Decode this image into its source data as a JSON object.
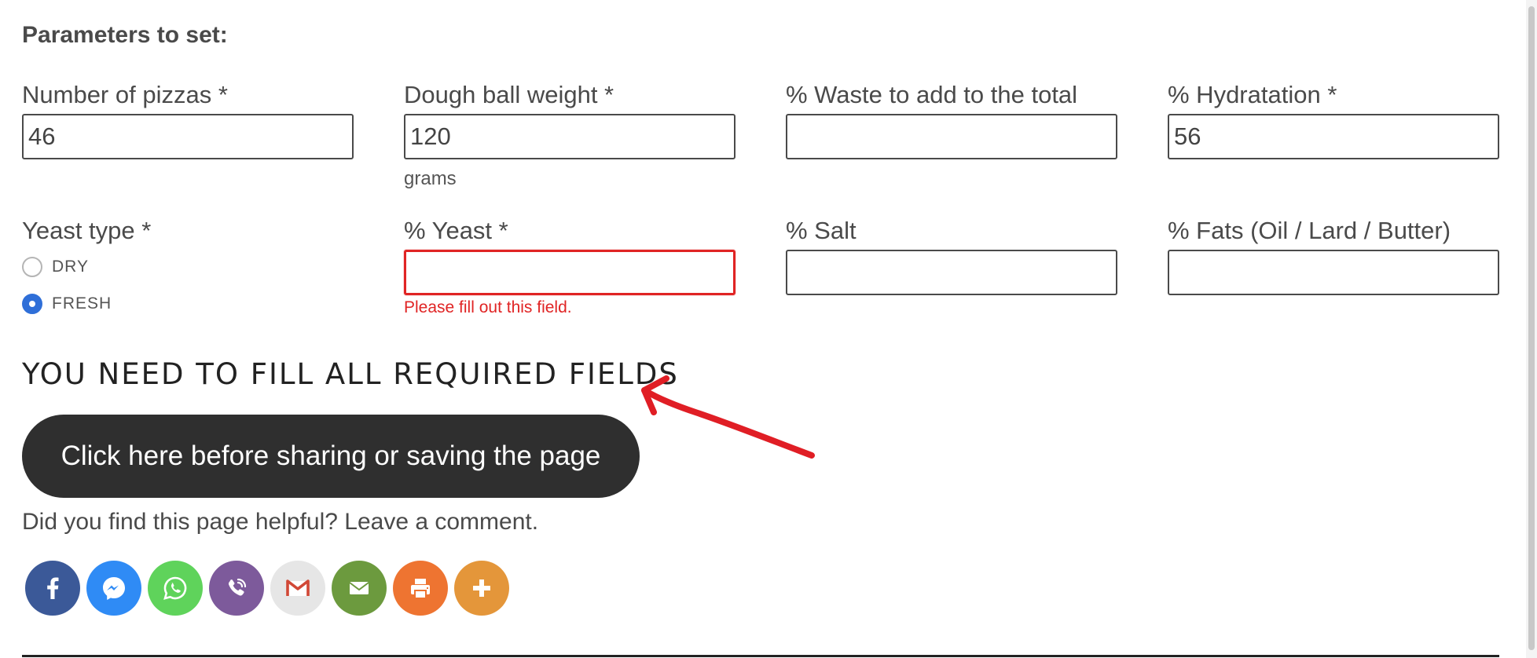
{
  "section_title": "Parameters to set:",
  "fields": {
    "pizzas": {
      "label": "Number of pizzas *",
      "value": "46",
      "placeholder": ""
    },
    "dough_weight": {
      "label": "Dough ball weight *",
      "value": "120",
      "placeholder": "",
      "help": "grams"
    },
    "waste": {
      "label": "% Waste to add to the total",
      "value": "",
      "placeholder": ""
    },
    "hydration": {
      "label": "% Hydratation *",
      "value": "56",
      "placeholder": ""
    },
    "yeast_type": {
      "label": "Yeast type *",
      "options": [
        {
          "label": "DRY",
          "checked": false
        },
        {
          "label": "FRESH",
          "checked": true
        }
      ]
    },
    "yeast": {
      "label": "% Yeast *",
      "value": "",
      "placeholder": "",
      "error": "Please fill out this field."
    },
    "salt": {
      "label": "% Salt",
      "value": "",
      "placeholder": ""
    },
    "fats": {
      "label": "% Fats (Oil / Lard / Butter)",
      "value": "",
      "placeholder": ""
    }
  },
  "warning_heading": "YOU NEED TO FILL ALL REQUIRED FIELDS",
  "cta_button_label": "Click here before sharing or saving the page",
  "helpful_text": "Did you find this page helpful? Leave a comment.",
  "share_buttons": [
    {
      "icon": "facebook-icon",
      "color": "#3b5998"
    },
    {
      "icon": "messenger-icon",
      "color": "#2f8bf5"
    },
    {
      "icon": "whatsapp-icon",
      "color": "#5fd35b"
    },
    {
      "icon": "viber-icon",
      "color": "#7d5a9b"
    },
    {
      "icon": "gmail-icon",
      "color": "#e6e6e6"
    },
    {
      "icon": "email-icon",
      "color": "#6c9a3e"
    },
    {
      "icon": "print-icon",
      "color": "#ee7431"
    },
    {
      "icon": "more-icon",
      "color": "#e4963a"
    }
  ],
  "colors": {
    "error": "#e02424",
    "radio_checked": "#2f6fd8",
    "annotation_arrow": "#e01e25",
    "cta_bg": "#2f2f2f"
  }
}
